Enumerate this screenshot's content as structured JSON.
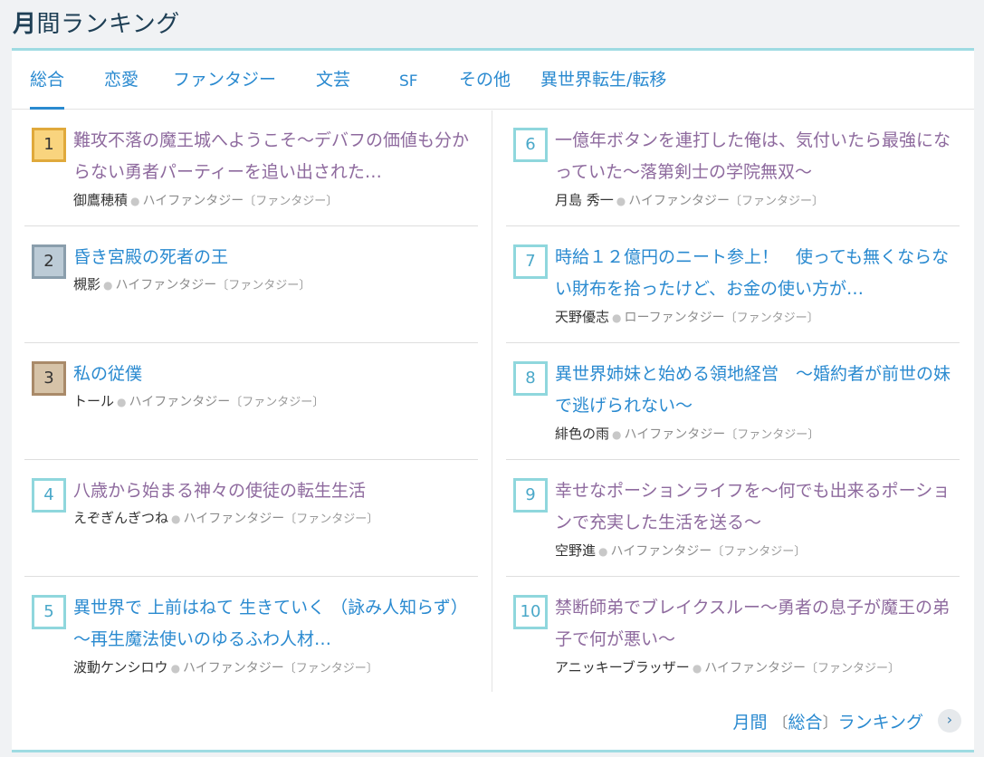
{
  "header": {
    "title_strong": "月",
    "title_rest": "間ランキング"
  },
  "tabs": [
    "総合",
    "恋愛",
    "ファンタジー",
    "文芸",
    "SF",
    "その他",
    "異世界転生/転移"
  ],
  "entries": [
    {
      "rank": "1",
      "title": "難攻不落の魔王城へようこそ～デバフの価値も分からない勇者パーティーを追い出された…",
      "author": "御鷹穂積",
      "genre": "ハイファンタジー",
      "category": "〔ファンタジー〕"
    },
    {
      "rank": "2",
      "title": "昏き宮殿の死者の王",
      "author": "槻影",
      "genre": "ハイファンタジー",
      "category": "〔ファンタジー〕"
    },
    {
      "rank": "3",
      "title": "私の従僕",
      "author": "トール",
      "genre": "ハイファンタジー",
      "category": "〔ファンタジー〕"
    },
    {
      "rank": "4",
      "title": "八歳から始まる神々の使徒の転生生活",
      "author": "えぞぎんぎつね",
      "genre": "ハイファンタジー",
      "category": "〔ファンタジー〕"
    },
    {
      "rank": "5",
      "title": "異世界で 上前はねて 生きていく （詠み人知らず） ～再生魔法使いのゆるふわ人材…",
      "author": "波動ケンシロウ",
      "genre": "ハイファンタジー",
      "category": "〔ファンタジー〕"
    },
    {
      "rank": "6",
      "title": "一億年ボタンを連打した俺は、気付いたら最強になっていた～落第剣士の学院無双～",
      "author": "月島 秀一",
      "genre": "ハイファンタジー",
      "category": "〔ファンタジー〕"
    },
    {
      "rank": "7",
      "title": "時給１２億円のニート参上！　使っても無くならない財布を拾ったけど、お金の使い方が…",
      "author": "天野優志",
      "genre": "ローファンタジー",
      "category": "〔ファンタジー〕"
    },
    {
      "rank": "8",
      "title": "異世界姉妹と始める領地経営　～婚約者が前世の妹で逃げられない～",
      "author": "緋色の雨",
      "genre": "ハイファンタジー",
      "category": "〔ファンタジー〕"
    },
    {
      "rank": "9",
      "title": "幸せなポーションライフを～何でも出来るポーションで充実した生活を送る～",
      "author": "空野進",
      "genre": "ハイファンタジー",
      "category": "〔ファンタジー〕"
    },
    {
      "rank": "10",
      "title": "禁断師弟でブレイクスルー～勇者の息子が魔王の弟子で何が悪い～",
      "author": "アニッキーブラッザー",
      "genre": "ハイファンタジー",
      "category": "〔ファンタジー〕"
    }
  ],
  "footer": {
    "link_month": "月間",
    "link_bracket_open": "〔",
    "link_category": "総合",
    "link_bracket_close": "〕",
    "link_rest": "ランキング"
  },
  "colors": {
    "link": "#2a8ad0",
    "visited": "#8e6a9e",
    "accent_border": "#9edbe2",
    "rank1": "#f9d47e",
    "rank2": "#bccbd6",
    "rank3": "#d6c3a8"
  },
  "icons": {
    "footer_chevron": "chevron-right-icon"
  }
}
